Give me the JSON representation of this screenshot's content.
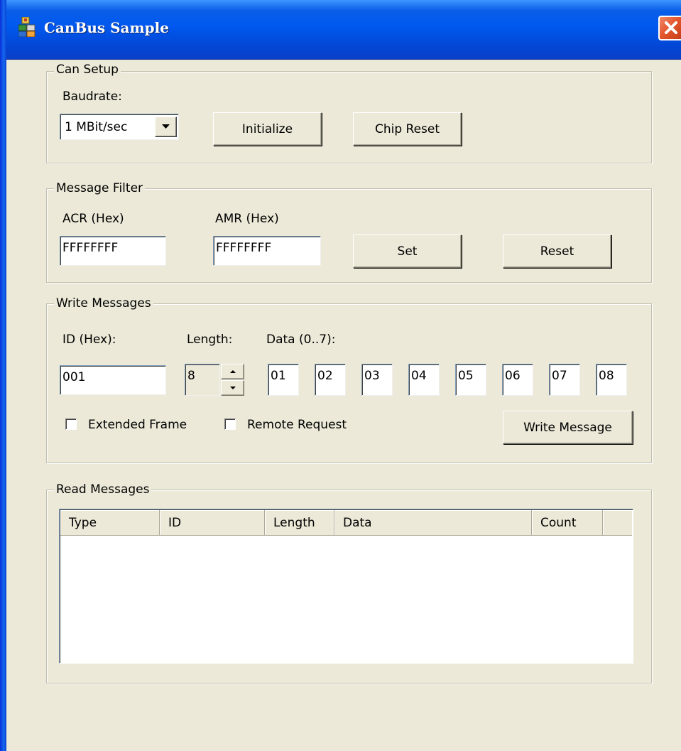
{
  "window": {
    "title": "CanBus Sample",
    "icon": "app-icon",
    "close_icon": "close-icon"
  },
  "can_setup": {
    "legend": "Can Setup",
    "baudrate_label": "Baudrate:",
    "baudrate_value": "1 MBit/sec",
    "initialize_label": "Initialize",
    "chip_reset_label": "Chip Reset"
  },
  "message_filter": {
    "legend": "Message Filter",
    "acr_label": "ACR (Hex)",
    "acr_value": "FFFFFFFF",
    "amr_label": "AMR (Hex)",
    "amr_value": "FFFFFFFF",
    "set_label": "Set",
    "reset_label": "Reset"
  },
  "write_messages": {
    "legend": "Write Messages",
    "id_label": "ID (Hex):",
    "id_value": "001",
    "length_label": "Length:",
    "length_value": "8",
    "data_label": "Data (0..7):",
    "data_bytes": [
      "01",
      "02",
      "03",
      "04",
      "05",
      "06",
      "07",
      "08"
    ],
    "extended_frame_label": "Extended Frame",
    "extended_frame_checked": false,
    "remote_request_label": "Remote Request",
    "remote_request_checked": false,
    "write_button_label": "Write Message"
  },
  "read_messages": {
    "legend": "Read Messages",
    "columns": [
      "Type",
      "ID",
      "Length",
      "Data",
      "Count"
    ],
    "rows": []
  }
}
